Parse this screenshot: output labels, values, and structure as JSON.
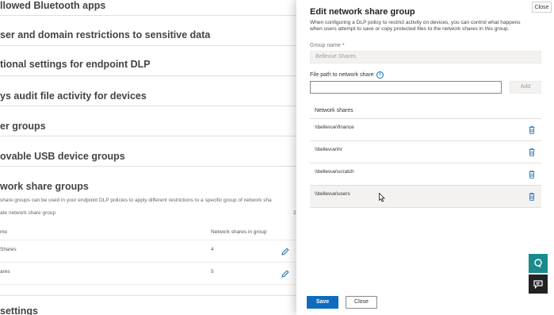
{
  "background": {
    "sections": [
      {
        "title": "llowed Bluetooth apps"
      },
      {
        "title": "ser and domain restrictions to sensitive data"
      },
      {
        "title": "tional settings for endpoint DLP"
      },
      {
        "title": "ys audit file activity for devices"
      },
      {
        "title": "er groups"
      },
      {
        "title": "ovable USB device groups"
      },
      {
        "title": "work share groups"
      }
    ],
    "network_share_desc": "share groups can be used in your endpoint DLP policies to apply different restrictions to a specific group of network sha",
    "create_label": "ate network share group",
    "count_label": "2",
    "table": {
      "col_name": "me",
      "col_shares": "Network shares in group",
      "rows": [
        {
          "name": "Shares",
          "count": "4"
        },
        {
          "name": "ares",
          "count": "5"
        }
      ]
    },
    "last_section": "settings"
  },
  "panel": {
    "title": "Edit network share group",
    "description_line1": "When configuring a DLP policy to restrict activity on devices, you can control what happens",
    "description_line2": "when users attempt to save or copy protected files to the network shares in this group.",
    "close_x_label": "Close",
    "group_name_label": "Group name *",
    "group_name_value": "Bellevue Shares",
    "file_path_label": "File path to network share",
    "file_path_value": "",
    "add_label": "Add",
    "shares_header": "Network shares",
    "shares": [
      {
        "path": "\\\\bellevue\\finance"
      },
      {
        "path": "\\\\bellevue\\hr"
      },
      {
        "path": "\\\\bellevue\\scratch"
      },
      {
        "path": "\\\\bellevue\\users"
      }
    ],
    "save_label": "Save",
    "close_label": "Close"
  },
  "colors": {
    "accent": "#0f6cbd",
    "help_fab": "#1a8a8a",
    "chat_fab": "#222222"
  },
  "icons": [
    "info-icon",
    "trash-icon",
    "pencil-icon",
    "help-icon",
    "chat-icon"
  ]
}
